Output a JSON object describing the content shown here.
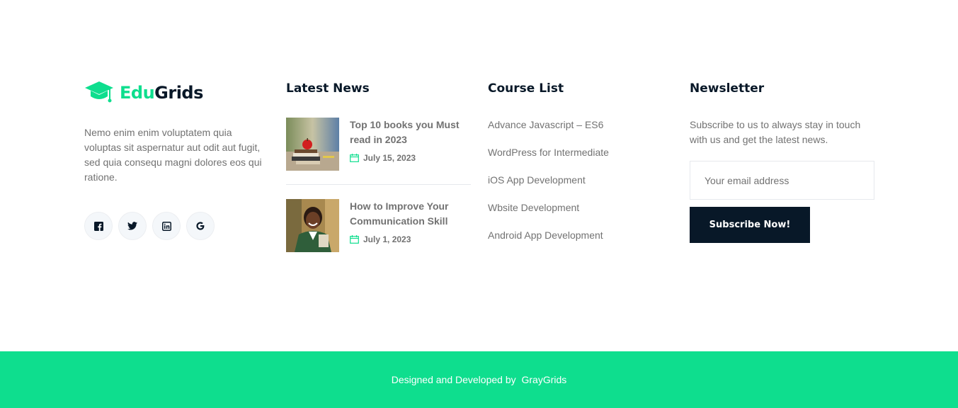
{
  "brand": {
    "name_part1": "Edu",
    "name_part2": "Grids",
    "accent_color": "#0ede8e",
    "dark_color": "#081828"
  },
  "about": {
    "text": "Nemo enim enim voluptatem quia voluptas sit aspernatur aut odit aut fugit, sed quia consequ magni dolores eos qui ratione."
  },
  "socials": [
    {
      "icon": "facebook-icon"
    },
    {
      "icon": "twitter-icon"
    },
    {
      "icon": "linkedin-icon"
    },
    {
      "icon": "google-icon"
    }
  ],
  "news": {
    "title": "Latest News",
    "items": [
      {
        "title": "Top 10 books you Must read in 2023",
        "date": "July 15, 2023",
        "thumb": "books-apple-image"
      },
      {
        "title": "How to Improve Your Communication Skill",
        "date": "July 1, 2023",
        "thumb": "student-girl-image"
      }
    ]
  },
  "courses": {
    "title": "Course List",
    "items": [
      "Advance Javascript – ES6",
      "WordPress for Intermediate",
      "iOS App Development",
      "Wbsite Development",
      "Android App Development"
    ]
  },
  "newsletter": {
    "title": "Newsletter",
    "text": "Subscribe to us to always stay in touch with us and get the latest news.",
    "email_placeholder": "Your email address",
    "button_label": "Subscribe Now!"
  },
  "footer": {
    "credit_text": "Designed and Developed by",
    "credit_link": "GrayGrids"
  }
}
